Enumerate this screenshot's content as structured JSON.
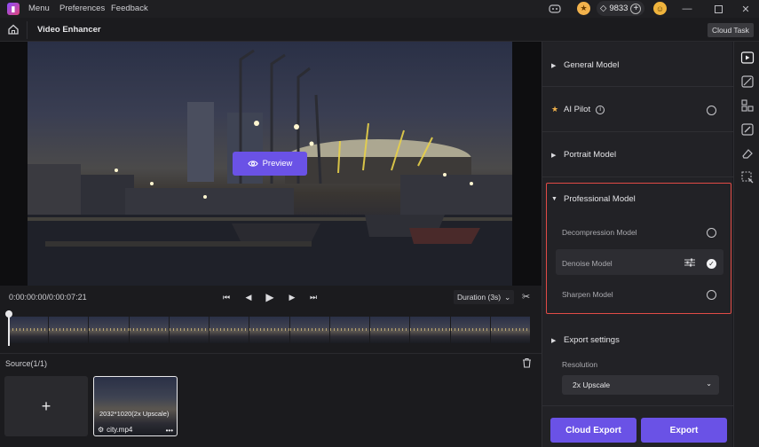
{
  "titlebar": {
    "menu": [
      "Menu",
      "Preferences",
      "Feedback"
    ],
    "credits": "9833"
  },
  "header": {
    "title": "Video Enhancer",
    "cloud_task": "Cloud Task"
  },
  "preview": {
    "button_label": "Preview"
  },
  "playback": {
    "time": "0:00:00:00/0:00:07:21",
    "duration": "Duration (3s)"
  },
  "source": {
    "label": "Source(1/1)",
    "add_label": "+",
    "clip": {
      "resolution": "2032*1020(2x Upscale)",
      "name": "city.mp4"
    }
  },
  "panel": {
    "general_model": "General Model",
    "ai_pilot": "AI Pilot",
    "portrait_model": "Portrait Model",
    "professional_model": "Professional Model",
    "pro_items": [
      "Decompression Model",
      "Denoise Model",
      "Sharpen Model"
    ],
    "selected_pro_item": "Denoise Model",
    "export_settings": "Export settings",
    "resolution_label": "Resolution",
    "resolution_value": "2x Upscale",
    "cloud_export": "Cloud Export",
    "export": "Export"
  },
  "colors": {
    "accent": "#6a52e6",
    "highlight_border": "#e24b46"
  }
}
